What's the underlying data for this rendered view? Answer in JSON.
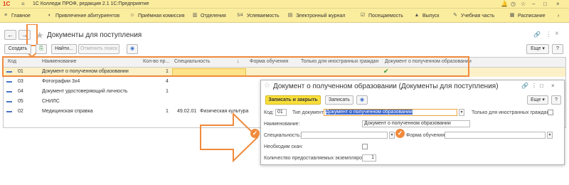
{
  "titlebar": {
    "logo": "1С",
    "app_title": "1С Колледж ПРОФ, редакция 2.1 1С:Предприятие"
  },
  "menu": {
    "items": [
      {
        "label": "Главное",
        "icon": "home-icon"
      },
      {
        "label": "Привлечение абитуриентов",
        "icon": "megaphone-icon"
      },
      {
        "label": "Приёмная комиссия",
        "icon": "people-icon"
      },
      {
        "label": "Отделения",
        "icon": "building-icon"
      },
      {
        "label": "Успеваемость",
        "icon": "grade-icon"
      },
      {
        "label": "Электронный журнал",
        "icon": "journal-icon"
      },
      {
        "label": "Посещаемость",
        "icon": "attendance-icon"
      },
      {
        "label": "Выпуск",
        "icon": "graduation-icon"
      },
      {
        "label": "Учебная часть",
        "icon": "study-icon"
      },
      {
        "label": "Расписание",
        "icon": "schedule-icon"
      }
    ],
    "grade_glyph": "5/4"
  },
  "window": {
    "title": "Документы для поступления"
  },
  "toolbar": {
    "create": "Создать",
    "find": "Найти...",
    "cancel_search": "Отменить поиск",
    "more": "Еще"
  },
  "grid": {
    "headers": [
      "Код",
      "Наименование",
      "Кол-во пр...",
      "Специальность",
      "Форма обучения",
      "Только для иностранных граждан",
      "Документ о полученном образовании"
    ],
    "rows": [
      {
        "code": "01",
        "name": "Документ о полученном образовании",
        "qty": "1",
        "spec_code": "",
        "spec": "",
        "form": "",
        "foreign": "",
        "edu": "✔",
        "selected": true
      },
      {
        "code": "03",
        "name": "Фотографии 3х4",
        "qty": "4",
        "spec_code": "",
        "spec": "",
        "form": "",
        "foreign": "",
        "edu": "",
        "selected": false
      },
      {
        "code": "04",
        "name": "Документ удостоверяющий личность",
        "qty": "1",
        "spec_code": "",
        "spec": "",
        "form": "",
        "foreign": "",
        "edu": "",
        "selected": false
      },
      {
        "code": "05",
        "name": "СНИЛС",
        "qty": "",
        "spec_code": "",
        "spec": "",
        "form": "",
        "foreign": "",
        "edu": "",
        "selected": false
      },
      {
        "code": "02",
        "name": "Медицинская справка",
        "qty": "1",
        "spec_code": "49.02.01",
        "spec": "Физическая культура",
        "form": "",
        "foreign": "",
        "edu": "",
        "selected": false
      }
    ]
  },
  "dialog": {
    "title": "Документ о полученном образовании (Документы для поступления)",
    "save_close": "Записать и закрыть",
    "save": "Записать",
    "more": "Еще",
    "help": "?",
    "code_label": "Код:",
    "code_value": "01",
    "doc_type_label": "Тип документа:",
    "doc_type_value": "Документ о полученном образовании",
    "foreign_label": "Только для иностранных граждан:",
    "name_label": "Наименование:",
    "name_value": "Документ о полученном образовании",
    "spec_label": "Специальность:",
    "spec_value": "",
    "form_label": "Форма обучения:",
    "form_value": "",
    "scan_label": "Необходим скан:",
    "copies_label": "Количество предоставляемых экземпляров:",
    "copies_value": "1"
  },
  "colors": {
    "accent": "#f08a3c",
    "menu_bg": "#fbed9e",
    "primary_button": "#f9df3b",
    "selected_row": "#fbf0c7"
  }
}
